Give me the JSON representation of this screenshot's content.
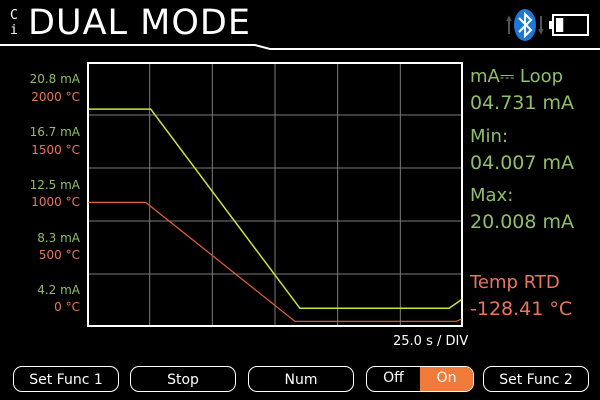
{
  "header": {
    "badge_top": "C",
    "badge_bottom": "i",
    "title": "DUAL  MODE",
    "bluetooth_icon": "bluetooth-icon",
    "battery_icon": "battery-icon",
    "battery_level": 0.25
  },
  "y_labels": [
    {
      "ma": "20.8 mA",
      "deg": "2000 °C"
    },
    {
      "ma": "16.7 mA",
      "deg": "1500 °C"
    },
    {
      "ma": "12.5 mA",
      "deg": "1000 °C"
    },
    {
      "ma": "8.3 mA",
      "deg": "500 °C"
    },
    {
      "ma": "4.2 mA",
      "deg": "0 °C"
    }
  ],
  "time_div_label": "25.0 s  /  DIV",
  "readouts": {
    "loop_header": "mA⎓  Loop",
    "loop_value": "04.731 mA",
    "min_header": "Min:",
    "min_value": "04.007 mA",
    "max_header": "Max:",
    "max_value": "20.008 mA",
    "temp_header": "Temp  RTD",
    "temp_value": "-128.41 °C"
  },
  "buttons": {
    "set_func_1": "Set Func 1",
    "stop": "Stop",
    "num": "Num",
    "toggle_off": "Off",
    "toggle_on": "On",
    "toggle_state": "On",
    "set_func_2": "Set Func 2"
  },
  "colors": {
    "ma_trace": "#c8e63c",
    "temp_trace": "#e8603a",
    "grid": "#7a7a7a",
    "accent": "#f07a3a"
  },
  "chart_data": {
    "type": "line",
    "x": [
      0,
      25,
      50,
      75,
      100,
      125,
      150
    ],
    "series": [
      {
        "name": "mA⎓  Loop",
        "x": [
          0,
          25,
          85,
          145,
          150
        ],
        "values": [
          20.0,
          20.0,
          4.0,
          4.0,
          4.7
        ]
      },
      {
        "name": "Temp  RTD",
        "x": [
          0,
          23,
          83,
          148,
          150
        ],
        "values": [
          1000,
          1000,
          -150,
          -150,
          -128
        ]
      }
    ],
    "xlim": [
      0,
      150
    ],
    "ylim_ma": [
      4.2,
      20.8
    ],
    "ylim_deg": [
      0,
      2000
    ],
    "grid": true
  }
}
